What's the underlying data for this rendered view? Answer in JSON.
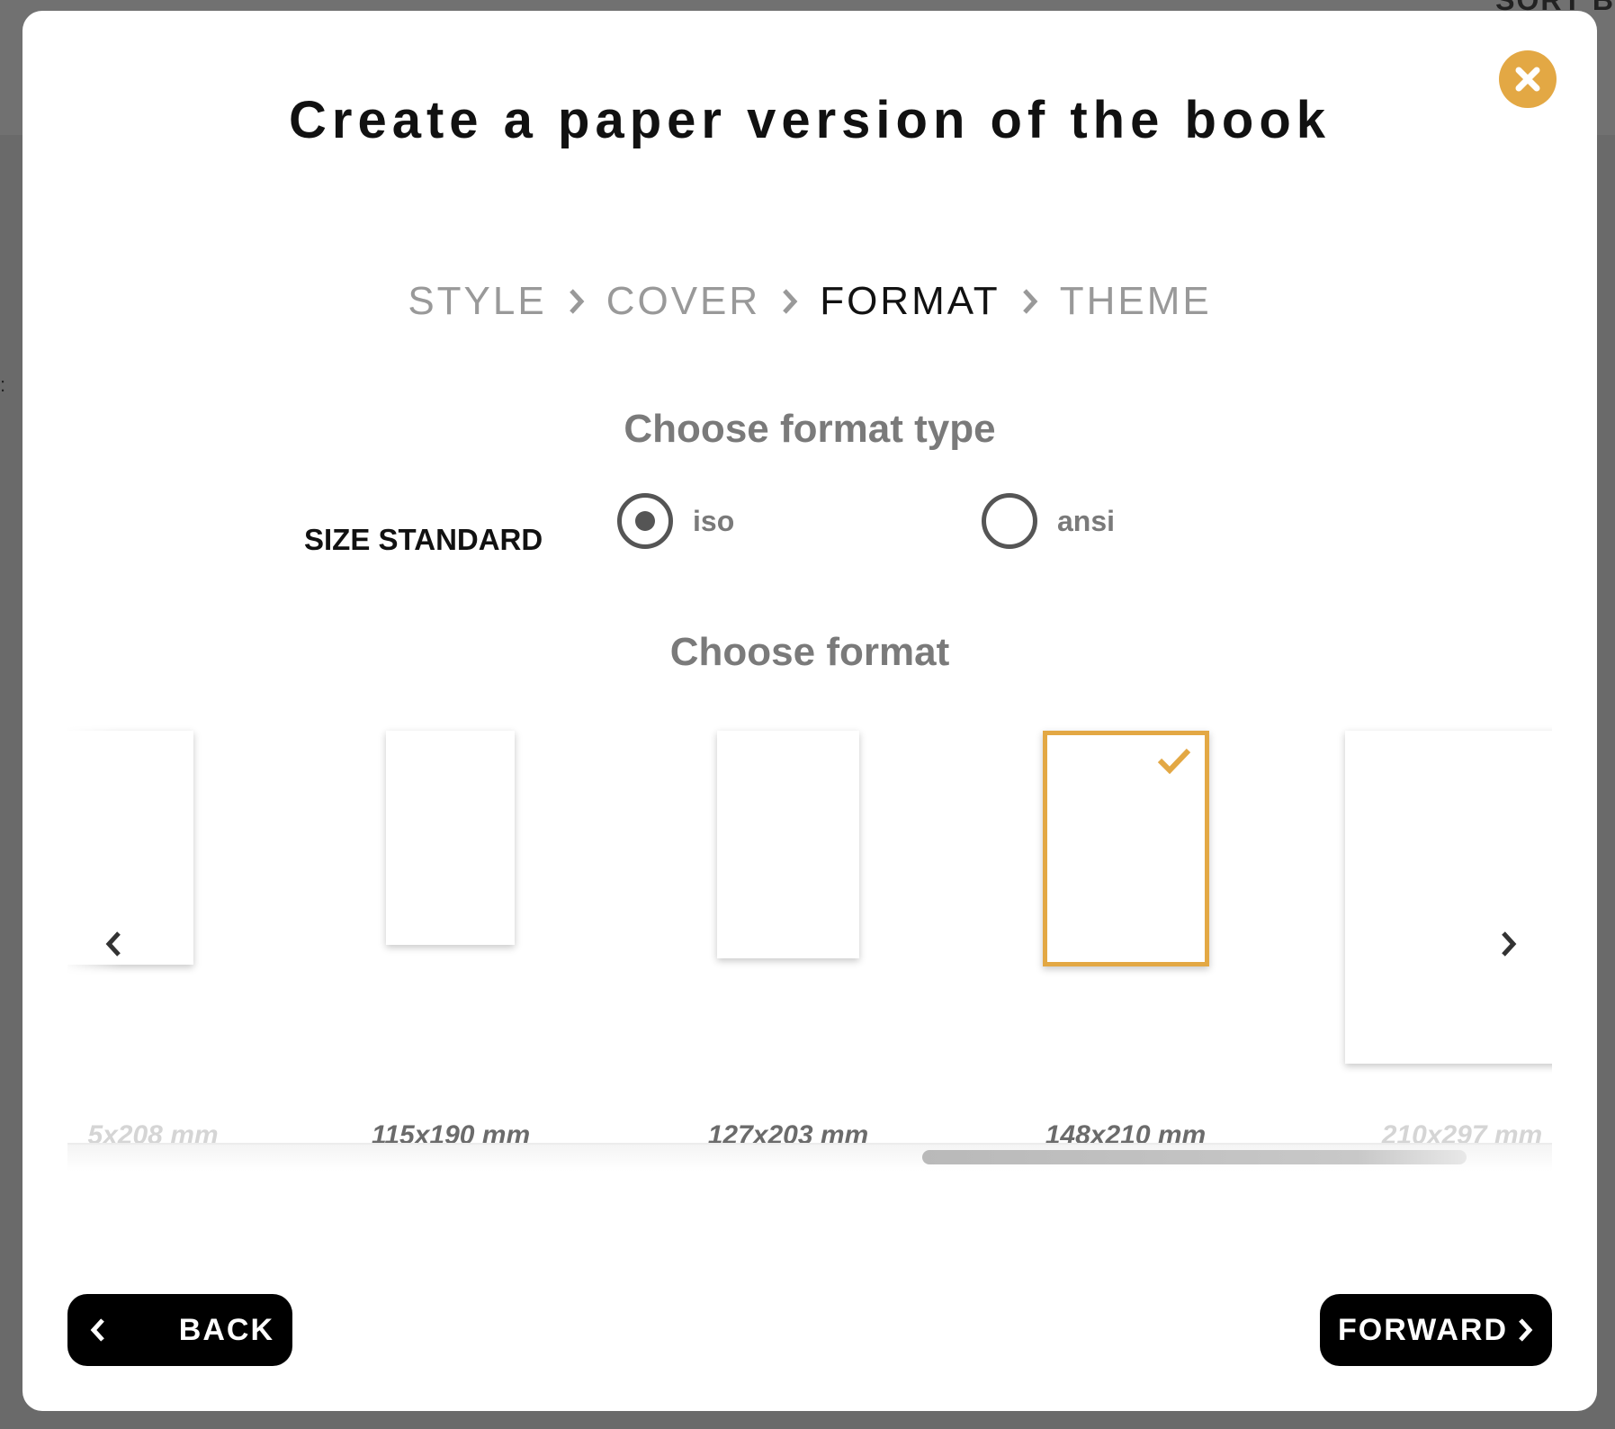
{
  "background": {
    "corner_text": "SORT B"
  },
  "modal": {
    "title": "Create a paper version of the book",
    "steps": [
      {
        "label": "STYLE",
        "active": false
      },
      {
        "label": "COVER",
        "active": false
      },
      {
        "label": "FORMAT",
        "active": true
      },
      {
        "label": "THEME",
        "active": false
      }
    ],
    "format_type": {
      "heading": "Choose format type",
      "size_standard_label": "SIZE STANDARD",
      "options": [
        {
          "label": "iso",
          "selected": true
        },
        {
          "label": "ansi",
          "selected": false
        }
      ]
    },
    "format": {
      "heading": "Choose format",
      "items": [
        {
          "label": "5x208 mm",
          "selected": false,
          "partial": true
        },
        {
          "label": "115x190 mm",
          "selected": false,
          "partial": false
        },
        {
          "label": "127x203 mm",
          "selected": false,
          "partial": false
        },
        {
          "label": "148x210 mm",
          "selected": true,
          "partial": false
        },
        {
          "label": "210x297 mm",
          "selected": false,
          "partial": true
        }
      ]
    },
    "buttons": {
      "back": "BACK",
      "forward": "FORWARD"
    }
  },
  "colors": {
    "accent": "#e3a844",
    "button_bg": "#000000",
    "step_inactive": "#999999",
    "step_active": "#111111"
  },
  "icons": {
    "close": "close-icon",
    "step_separator": "chevron-right-icon",
    "selected_mark": "checkmark-icon",
    "prev": "chevron-left-icon",
    "next": "chevron-right-icon"
  }
}
